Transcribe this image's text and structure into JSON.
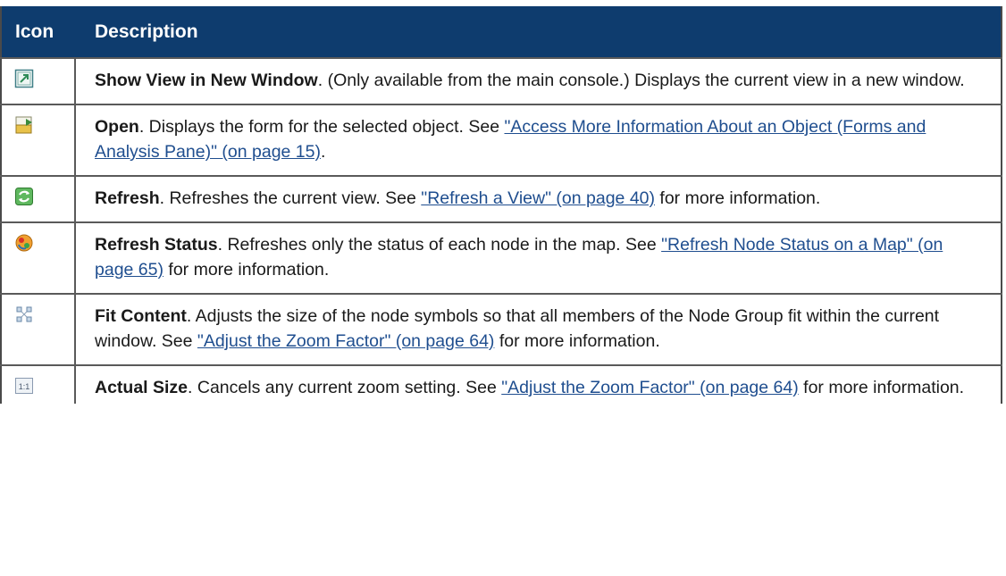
{
  "table": {
    "headers": {
      "icon": "Icon",
      "description": "Description"
    },
    "rows": [
      {
        "icon": "show-view-in-new-window-icon",
        "term": "Show View in New Window",
        "text1": ". (Only available from the main console.) Displays the current view in a new window.",
        "link": "",
        "text2": ""
      },
      {
        "icon": "open-form-icon",
        "term": "Open",
        "text1": ". Displays the form for the selected object. See ",
        "link": "\"Access More Information About an Object (Forms and Analysis Pane)\" (on page 15)",
        "text2": "."
      },
      {
        "icon": "refresh-icon",
        "term": "Refresh",
        "text1": ". Refreshes the current view. See ",
        "link": "\"Refresh a View\" (on page 40)",
        "text2": " for more information."
      },
      {
        "icon": "refresh-status-icon",
        "term": "Refresh Status",
        "text1": ". Refreshes only the status of each node in the map. See ",
        "link": "\"Refresh Node Status on a Map\" (on page 65)",
        "text2": " for more information."
      },
      {
        "icon": "fit-content-icon",
        "term": "Fit Content",
        "text1": ". Adjusts the size of the node symbols so that all members of the Node Group fit within the current window. See ",
        "link": "\"Adjust the Zoom Factor\" (on page 64)",
        "text2": " for more information."
      },
      {
        "icon": "actual-size-icon",
        "term": "Actual Size",
        "text1": ". Cancels any current zoom setting. See ",
        "link": "\"Adjust the Zoom Factor\" (on page 64)",
        "text2": " for more information.",
        "icon_text": "1:1"
      }
    ]
  }
}
